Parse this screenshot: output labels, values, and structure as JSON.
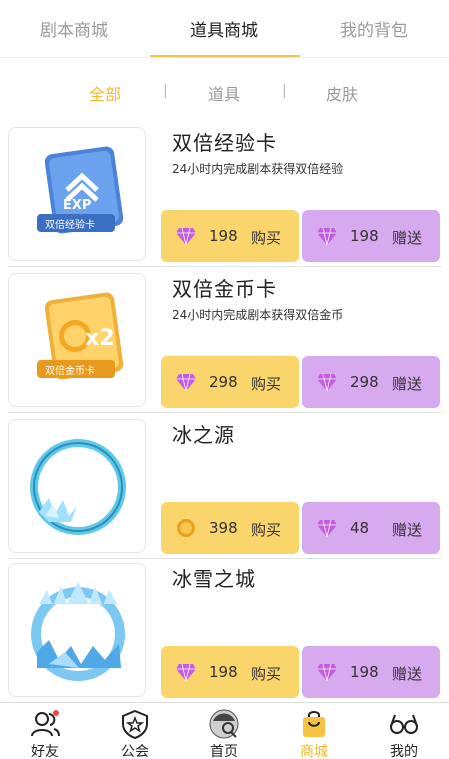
{
  "top_tabs": [
    "剧本商城",
    "道具商城",
    "我的背包"
  ],
  "filters": [
    "全部",
    "道具",
    "皮肤"
  ],
  "filter_separator": "|",
  "items": [
    {
      "name": "双倍经验卡",
      "desc": "24小时内完成剧本获得双倍经验",
      "thumb_badge": "EXP",
      "thumb_caption": "双倍经验卡",
      "buy": {
        "currency": "diamond",
        "price": "198",
        "label": "购买"
      },
      "gift": {
        "currency": "diamond",
        "price": "198",
        "label": "赠送"
      }
    },
    {
      "name": "双倍金币卡",
      "desc": "24小时内完成剧本获得双倍金币",
      "thumb_badge": "x2",
      "thumb_caption": "双倍金币卡",
      "buy": {
        "currency": "diamond",
        "price": "298",
        "label": "购买"
      },
      "gift": {
        "currency": "diamond",
        "price": "298",
        "label": "赠送"
      }
    },
    {
      "name": "冰之源",
      "desc": "",
      "buy": {
        "currency": "coin",
        "price": "398",
        "label": "购买"
      },
      "gift": {
        "currency": "diamond",
        "price": "48",
        "label": "赠送"
      }
    },
    {
      "name": "冰雪之城",
      "desc": "",
      "buy": {
        "currency": "diamond",
        "price": "198",
        "label": "购买"
      },
      "gift": {
        "currency": "diamond",
        "price": "198",
        "label": "赠送"
      }
    }
  ],
  "bottom_nav": [
    "好友",
    "公会",
    "首页",
    "商城",
    "我的"
  ],
  "colors": {
    "accent": "#f1b92c",
    "buy_button": "#f9d56b",
    "gift_button": "#d7a9ef",
    "diamond": "#c45be0",
    "notification_dot": "#e84c4c"
  }
}
